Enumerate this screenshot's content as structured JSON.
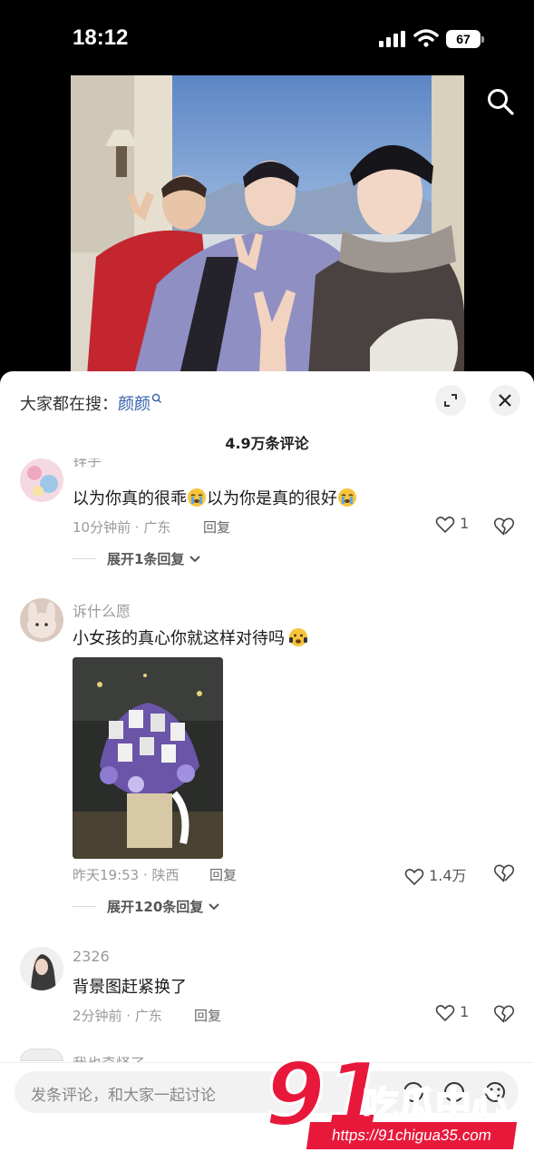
{
  "status_bar": {
    "time": "18:12",
    "battery": "67"
  },
  "sheet": {
    "search_prefix": "大家都在搜：",
    "search_keyword": "颜颜",
    "comment_count": "4.9万条评论"
  },
  "comments": [
    {
      "username": "锌芋",
      "text_a": "以为你真的很乖",
      "text_b": "以为你是真的很好",
      "emoji": "crying-face-icon",
      "meta": "10分钟前 · 广东",
      "reply_label": "回复",
      "likes": "1",
      "expand_label": "展开1条回复"
    },
    {
      "username": "诉什么愿",
      "text": "小女孩的真心你就这样对待吗",
      "emoji": "sad-face-icon",
      "meta": "昨天19:53 · 陕西",
      "reply_label": "回复",
      "likes": "1.4万",
      "expand_label": "展开120条回复"
    },
    {
      "username": "2326",
      "text": "背景图赶紧换了",
      "meta": "2分钟前 · 广东",
      "reply_label": "回复",
      "likes": "1"
    },
    {
      "username": "我也奇怪了"
    }
  ],
  "input": {
    "placeholder": "发条评论，和大家一起讨论"
  },
  "watermark": {
    "brand": "91吃瓜中心",
    "url": "https://91chigua35.com"
  },
  "colors": {
    "keyword": "#2f5fa8",
    "watermark": "#e8183b"
  }
}
